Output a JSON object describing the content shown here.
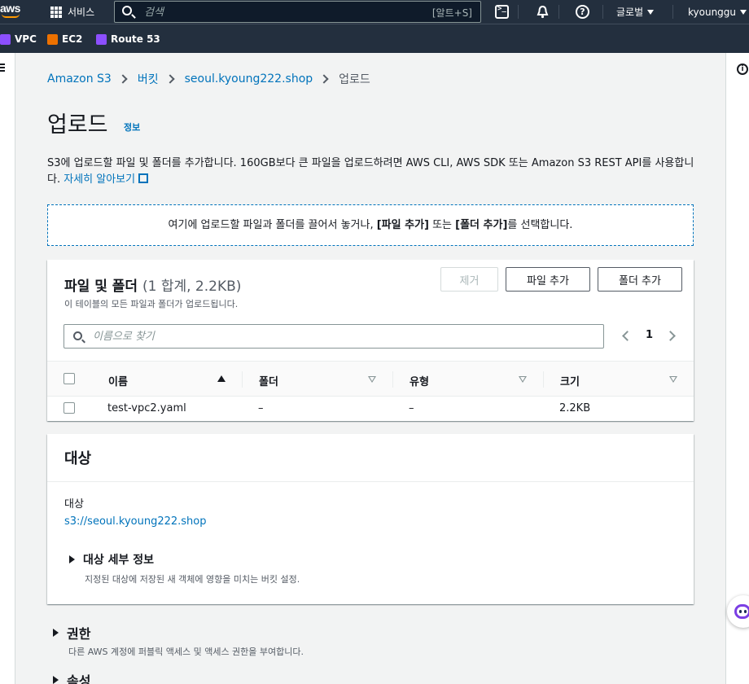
{
  "topnav": {
    "logo": "aws",
    "services_label": "서비스",
    "search_placeholder": "검색",
    "search_shortcut": "[알트+S]",
    "region_label": "글로벌",
    "user_label": "kyounggu",
    "icons": [
      "grid-icon",
      "search-icon",
      "terminal-icon",
      "bell-icon",
      "help-icon"
    ]
  },
  "favorites": [
    {
      "label": "VPC",
      "color": "#8c4fff"
    },
    {
      "label": "EC2",
      "color": "#ed7100"
    },
    {
      "label": "Route 53",
      "color": "#8c4fff"
    }
  ],
  "breadcrumb": {
    "items": [
      "Amazon S3",
      "버킷",
      "seoul.kyoung222.shop"
    ],
    "current": "업로드"
  },
  "page": {
    "title": "업로드",
    "info_link": "정보",
    "description": "S3에 업로드할 파일 및 폴더를 추가합니다. 160GB보다 큰 파일을 업로드하려면 AWS CLI, AWS SDK 또는 Amazon S3 REST API를 사용합니다.",
    "learn_more": "자세히 알아보기"
  },
  "dropzone": {
    "text_before": "여기에 업로드할 파일과 폴더를 끌어서 놓거나, ",
    "bold1": "[파일 추가]",
    "text_mid": " 또는 ",
    "bold2": "[폴더 추가]",
    "text_after": "를 선택합니다."
  },
  "files": {
    "title": "파일 및 폴더",
    "count": "(1 합계, 2.2KB)",
    "subtitle": "이 테이블의 모든 파일과 폴더가 업로드됩니다.",
    "remove_label": "제거",
    "add_file_label": "파일 추가",
    "add_folder_label": "폴더 추가",
    "filter_placeholder": "이름으로 찾기",
    "page": "1",
    "columns": [
      "이름",
      "폴더",
      "유형",
      "크기"
    ],
    "rows": [
      {
        "name": "test-vpc2.yaml",
        "folder": "–",
        "type": "–",
        "size": "2.2KB"
      }
    ]
  },
  "destination": {
    "title": "대상",
    "label": "대상",
    "url": "s3://seoul.kyoung222.shop",
    "detail_title": "대상 세부 정보",
    "detail_sub": "지정된 대상에 저장된 새 객체에 영향을 미치는 버킷 설정."
  },
  "permissions": {
    "title": "권한",
    "subtitle": "다른 AWS 계정에 퍼블릭 액세스 및 액세스 권한을 부여합니다."
  },
  "properties": {
    "title": "속성"
  },
  "colors": {
    "nav_bg": "#232f3e",
    "link": "#0073bb",
    "accent": "#ff9900"
  }
}
